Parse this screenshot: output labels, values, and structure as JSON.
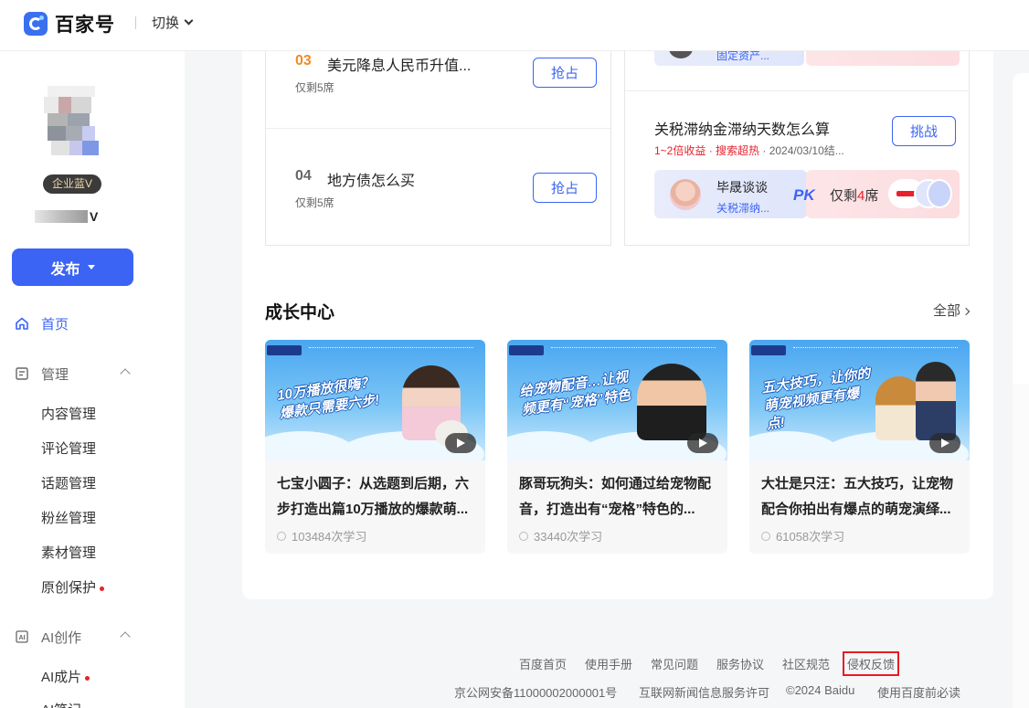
{
  "header": {
    "brand": "百家号",
    "switch_label": "切换"
  },
  "sidebar": {
    "badge": "企业蓝V",
    "username_suffix": "V",
    "publish_label": "发布",
    "home": "首页",
    "manage": "管理",
    "manage_items": [
      "内容管理",
      "评论管理",
      "话题管理",
      "粉丝管理",
      "素材管理",
      "原创保护"
    ],
    "ai": "AI创作",
    "ai_items": [
      "AI成片",
      "AI笔记"
    ]
  },
  "hot_topics_left": [
    {
      "num": "03",
      "title": "美元降息人民币升值...",
      "sub": "仅剩5席",
      "button": "抢占",
      "num_color": "#f08a24"
    },
    {
      "num": "04",
      "title": "地方债怎么买",
      "sub": "仅剩5席",
      "button": "抢占",
      "num_color": "#666666"
    }
  ],
  "hot_topics_right": {
    "top_partial_text": "固定资产...",
    "title": "关税滞纳金滞纳天数怎么算",
    "meta_red": "1~2倍收益 · 搜索超热",
    "meta_gray": " · 2024/03/10结...",
    "button": "挑战",
    "pk_name": "毕晟谈谈",
    "pk_topic": "关税滞纳...",
    "pk_label": "PK",
    "seats_prefix": "仅剩",
    "seats_num": "4",
    "seats_suffix": "席"
  },
  "growth": {
    "title": "成长中心",
    "all_link": "全部",
    "courses": [
      {
        "headline": "10万播放很嗨？爆款只需要六步!",
        "title": "七宝小圆子：从选题到后期，六步打造出篇10万播放的爆款萌...",
        "learners": "103484次学习"
      },
      {
        "headline": "给宠物配音…让视频更有“宠格”特色",
        "title": "豚哥玩狗头：如何通过给宠物配音，打造出有“宠格”特色的...",
        "learners": "33440次学习"
      },
      {
        "headline": "五大技巧，让你的萌宠视频更有爆点!",
        "title": "大壮是只汪：五大技巧，让宠物配合你拍出有爆点的萌宠演绎...",
        "learners": "61058次学习"
      }
    ]
  },
  "footer": {
    "links": [
      "百度首页",
      "使用手册",
      "常见问题",
      "服务协议",
      "社区规范",
      "侵权反馈"
    ],
    "icp": "京公网安备11000002000001号",
    "license": "互联网新闻信息服务许可",
    "copyright": "©2024 Baidu",
    "notice": "使用百度前必读"
  },
  "colors": {
    "accent": "#3b64f5",
    "highlight_box": "#e51c23",
    "hot_red": "#e8212c"
  }
}
